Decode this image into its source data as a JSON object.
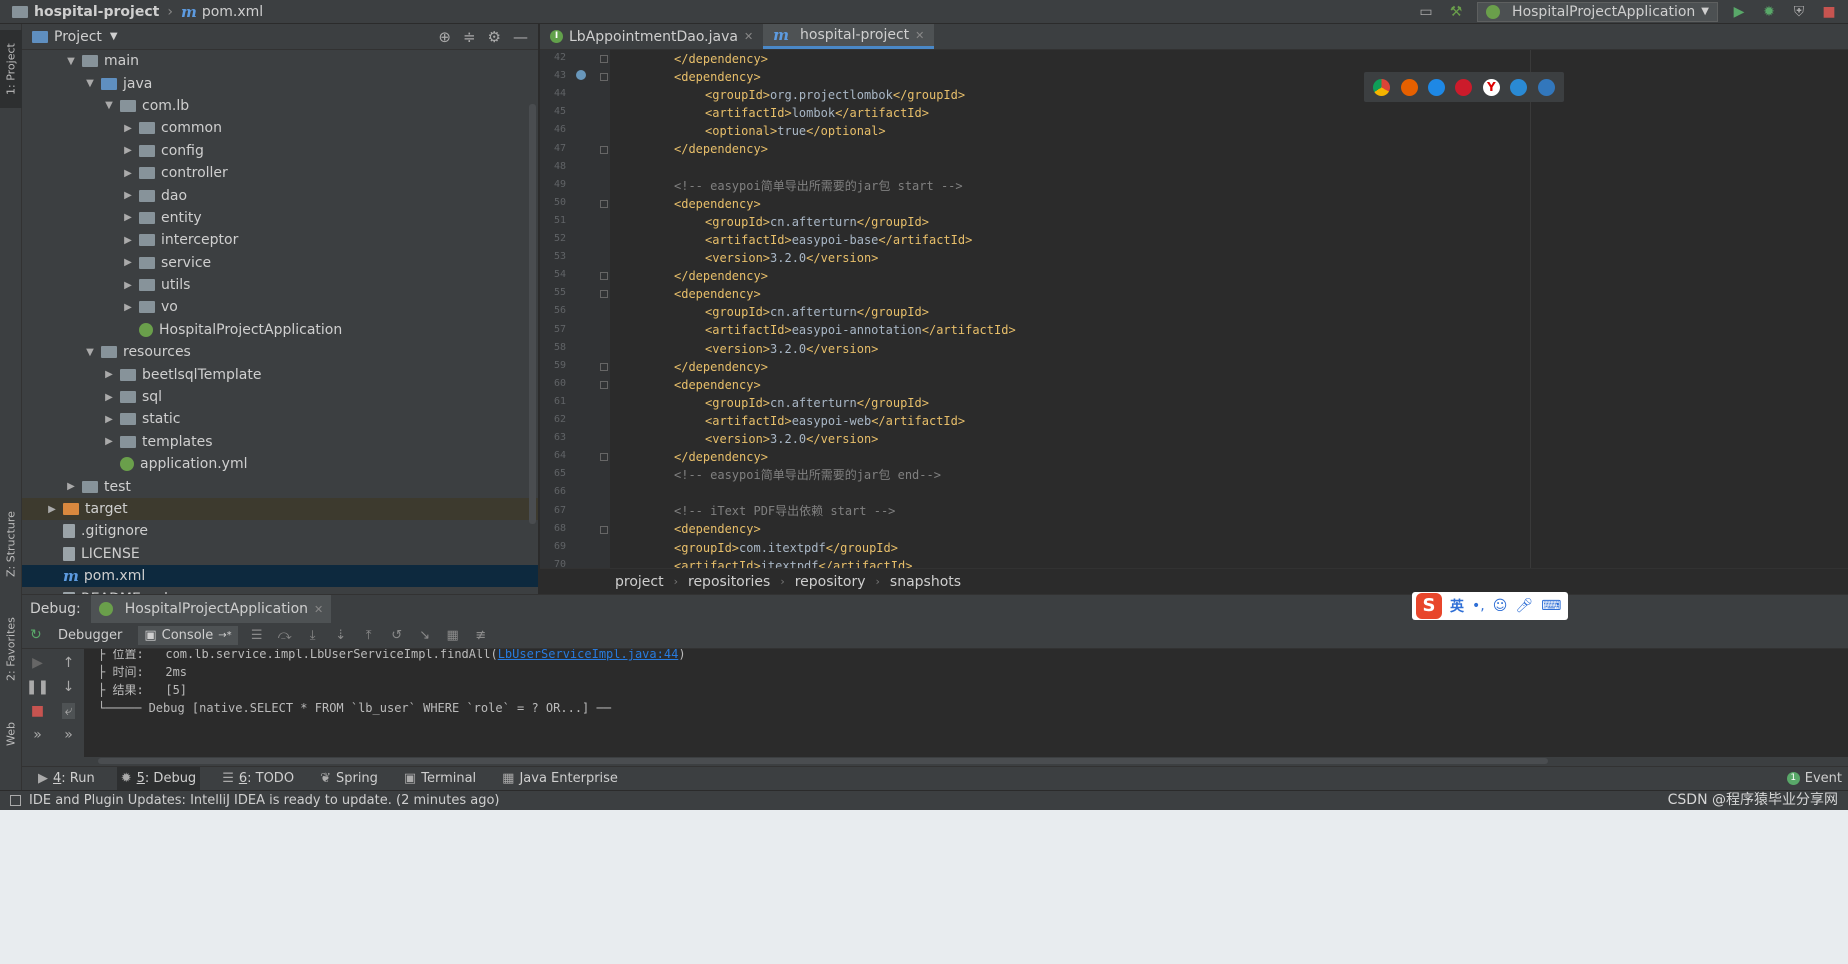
{
  "titlebar": {
    "project": "hospital-project",
    "file": "pom.xml",
    "run_config": "HospitalProjectApplication"
  },
  "left_strip": {
    "project_tab": "1: Project",
    "structure_tab": "Z: Structure",
    "favorites_tab": "2: Favorites",
    "web_tab": "Web"
  },
  "project_panel": {
    "title": "Project",
    "tree": [
      {
        "label": "main",
        "indent": 2,
        "arrow": "down",
        "icon": "folder"
      },
      {
        "label": "java",
        "indent": 3,
        "arrow": "down",
        "icon": "folder-blue"
      },
      {
        "label": "com.lb",
        "indent": 4,
        "arrow": "down",
        "icon": "package"
      },
      {
        "label": "common",
        "indent": 5,
        "arrow": "right",
        "icon": "package"
      },
      {
        "label": "config",
        "indent": 5,
        "arrow": "right",
        "icon": "package"
      },
      {
        "label": "controller",
        "indent": 5,
        "arrow": "right",
        "icon": "package"
      },
      {
        "label": "dao",
        "indent": 5,
        "arrow": "right",
        "icon": "package"
      },
      {
        "label": "entity",
        "indent": 5,
        "arrow": "right",
        "icon": "package"
      },
      {
        "label": "interceptor",
        "indent": 5,
        "arrow": "right",
        "icon": "package"
      },
      {
        "label": "service",
        "indent": 5,
        "arrow": "right",
        "icon": "package"
      },
      {
        "label": "utils",
        "indent": 5,
        "arrow": "right",
        "icon": "package"
      },
      {
        "label": "vo",
        "indent": 5,
        "arrow": "right",
        "icon": "package"
      },
      {
        "label": "HospitalProjectApplication",
        "indent": 5,
        "arrow": "none",
        "icon": "spring"
      },
      {
        "label": "resources",
        "indent": 3,
        "arrow": "down",
        "icon": "folder"
      },
      {
        "label": "beetlsqlTemplate",
        "indent": 4,
        "arrow": "right",
        "icon": "folder"
      },
      {
        "label": "sql",
        "indent": 4,
        "arrow": "right",
        "icon": "folder"
      },
      {
        "label": "static",
        "indent": 4,
        "arrow": "right",
        "icon": "folder"
      },
      {
        "label": "templates",
        "indent": 4,
        "arrow": "right",
        "icon": "folder"
      },
      {
        "label": "application.yml",
        "indent": 4,
        "arrow": "none",
        "icon": "spring"
      },
      {
        "label": "test",
        "indent": 2,
        "arrow": "right",
        "icon": "folder"
      },
      {
        "label": "target",
        "indent": 1,
        "arrow": "right",
        "icon": "folder-orange",
        "state": "highlight"
      },
      {
        "label": ".gitignore",
        "indent": 1,
        "arrow": "none",
        "icon": "file"
      },
      {
        "label": "LICENSE",
        "indent": 1,
        "arrow": "none",
        "icon": "file"
      },
      {
        "label": "pom.xml",
        "indent": 1,
        "arrow": "none",
        "icon": "maven",
        "state": "selected"
      },
      {
        "label": "README.md",
        "indent": 1,
        "arrow": "none",
        "icon": "file"
      }
    ]
  },
  "editor": {
    "tabs": [
      {
        "label": "LbAppointmentDao.java",
        "icon": "interface-icon",
        "active": false
      },
      {
        "label": "hospital-project",
        "icon": "maven-icon",
        "active": true
      }
    ],
    "lines": [
      {
        "n": "42",
        "indent": 1,
        "kind": "tag",
        "text": "</dependency>"
      },
      {
        "n": "43",
        "indent": 1,
        "kind": "tag",
        "text": "<dependency>"
      },
      {
        "n": "44",
        "indent": 2,
        "kind": "elem",
        "open": "<groupId>",
        "value": "org.projectlombok",
        "close": "</groupId>"
      },
      {
        "n": "45",
        "indent": 2,
        "kind": "elem",
        "open": "<artifactId>",
        "value": "lombok",
        "close": "</artifactId>"
      },
      {
        "n": "46",
        "indent": 2,
        "kind": "elem",
        "open": "<optional>",
        "value": "true",
        "close": "</optional>"
      },
      {
        "n": "47",
        "indent": 1,
        "kind": "tag",
        "text": "</dependency>"
      },
      {
        "n": "48",
        "indent": 0,
        "kind": "blank",
        "text": ""
      },
      {
        "n": "49",
        "indent": 1,
        "kind": "comment",
        "text": "<!-- easypoi简单导出所需要的jar包 start -->"
      },
      {
        "n": "50",
        "indent": 1,
        "kind": "tag",
        "text": "<dependency>"
      },
      {
        "n": "51",
        "indent": 2,
        "kind": "elem",
        "open": "<groupId>",
        "value": "cn.afterturn",
        "close": "</groupId>"
      },
      {
        "n": "52",
        "indent": 2,
        "kind": "elem",
        "open": "<artifactId>",
        "value": "easypoi-base",
        "close": "</artifactId>"
      },
      {
        "n": "53",
        "indent": 2,
        "kind": "elem",
        "open": "<version>",
        "value": "3.2.0",
        "close": "</version>"
      },
      {
        "n": "54",
        "indent": 1,
        "kind": "tag",
        "text": "</dependency>"
      },
      {
        "n": "55",
        "indent": 1,
        "kind": "tag",
        "text": "<dependency>"
      },
      {
        "n": "56",
        "indent": 2,
        "kind": "elem",
        "open": "<groupId>",
        "value": "cn.afterturn",
        "close": "</groupId>"
      },
      {
        "n": "57",
        "indent": 2,
        "kind": "elem",
        "open": "<artifactId>",
        "value": "easypoi-annotation",
        "close": "</artifactId>"
      },
      {
        "n": "58",
        "indent": 2,
        "kind": "elem",
        "open": "<version>",
        "value": "3.2.0",
        "close": "</version>"
      },
      {
        "n": "59",
        "indent": 1,
        "kind": "tag",
        "text": "</dependency>"
      },
      {
        "n": "60",
        "indent": 1,
        "kind": "tag",
        "text": "<dependency>"
      },
      {
        "n": "61",
        "indent": 2,
        "kind": "elem",
        "open": "<groupId>",
        "value": "cn.afterturn",
        "close": "</groupId>"
      },
      {
        "n": "62",
        "indent": 2,
        "kind": "elem",
        "open": "<artifactId>",
        "value": "easypoi-web",
        "close": "</artifactId>"
      },
      {
        "n": "63",
        "indent": 2,
        "kind": "elem",
        "open": "<version>",
        "value": "3.2.0",
        "close": "</version>"
      },
      {
        "n": "64",
        "indent": 1,
        "kind": "tag",
        "text": "</dependency>"
      },
      {
        "n": "65",
        "indent": 1,
        "kind": "comment",
        "text": "<!-- easypoi简单导出所需要的jar包 end-->"
      },
      {
        "n": "66",
        "indent": 0,
        "kind": "blank",
        "text": ""
      },
      {
        "n": "67",
        "indent": 1,
        "kind": "comment",
        "text": "<!-- iText PDF导出依赖 start -->"
      },
      {
        "n": "68",
        "indent": 1,
        "kind": "tag",
        "text": "<dependency>"
      },
      {
        "n": "69",
        "indent": 1,
        "kind": "elem",
        "open": "<groupId>",
        "value": "com.itextpdf",
        "close": "</groupId>"
      },
      {
        "n": "70",
        "indent": 1,
        "kind": "elem",
        "open": "<artifactId>",
        "value": "itextpdf",
        "close": "</artifactId>"
      }
    ],
    "breadcrumbs": [
      "project",
      "repositories",
      "repository",
      "snapshots"
    ]
  },
  "debug": {
    "label": "Debug:",
    "session": "HospitalProjectApplication",
    "debugger_tab": "Debugger",
    "console_tab": "Console",
    "console_lines": [
      {
        "text": "├ 位置:   com.lb.service.impl.LbUserServiceImpl.findAll(",
        "link": "LbUserServiceImpl.java:44",
        "suffix": ")"
      },
      {
        "text": "├ 时间:   2ms",
        "link": "",
        "suffix": ""
      },
      {
        "text": "├ 结果:   [5]",
        "link": "",
        "suffix": ""
      },
      {
        "text": "└───── Debug [native.SELECT * FROM `lb_user` WHERE `role` = ? OR...] ──",
        "link": "",
        "suffix": ""
      }
    ]
  },
  "tool_tabs": [
    {
      "num": "4",
      "label": ": Run",
      "icon": "run-icon",
      "active": false
    },
    {
      "num": "5",
      "label": ": Debug",
      "icon": "bug-icon",
      "active": true
    },
    {
      "num": "6",
      "label": ": TODO",
      "icon": "todo-icon",
      "active": false
    },
    {
      "num": "",
      "label": "Spring",
      "icon": "spring-icon",
      "active": false
    },
    {
      "num": "",
      "label": "Terminal",
      "icon": "terminal-icon",
      "active": false
    },
    {
      "num": "",
      "label": "Java Enterprise",
      "icon": "java-enterprise-icon",
      "active": false
    }
  ],
  "event_log": {
    "badge": "1",
    "label": "Event"
  },
  "statusbar": {
    "message": "IDE and Plugin Updates: IntelliJ IDEA is ready to update. (2 minutes ago)"
  },
  "watermark": "CSDN @程序猿毕业分享网",
  "ime": {
    "logo": "S",
    "mode": "英",
    "punct": "•,"
  },
  "colors": {
    "accent": "#4a88c7",
    "tag": "#e8bf6a",
    "text": "#a9b7c6",
    "comment": "#808080",
    "link": "#287bde",
    "selected": "#0d293e"
  }
}
